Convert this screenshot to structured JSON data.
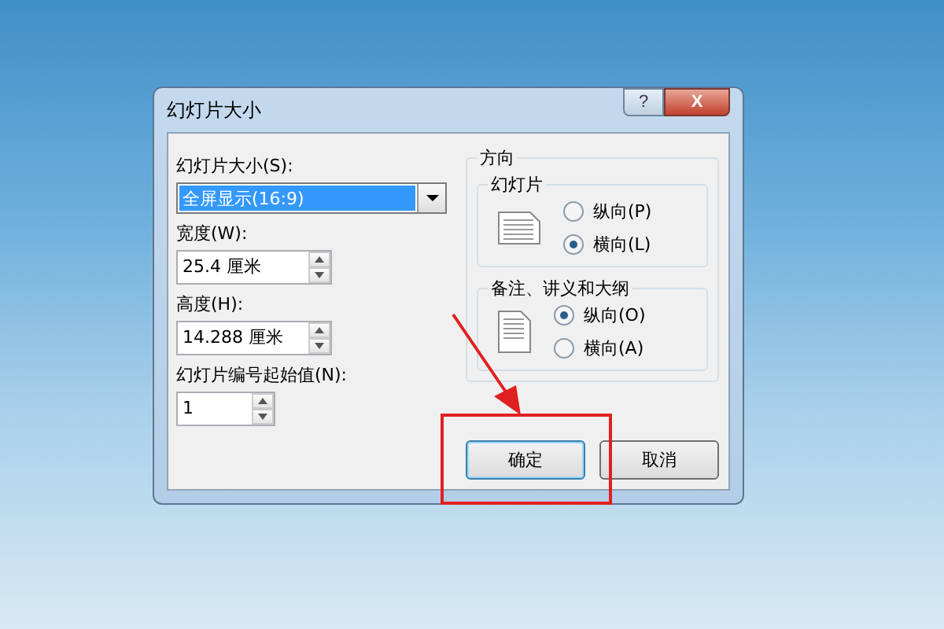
{
  "window": {
    "title": "幻灯片大小",
    "help_button": "?",
    "close_button": "X"
  },
  "slide_size": {
    "label": "幻灯片大小(S):",
    "value": "全屏显示(16:9)"
  },
  "width": {
    "label": "宽度(W):",
    "value": "25.4 厘米"
  },
  "height": {
    "label": "高度(H):",
    "value": "14.288 厘米"
  },
  "start_number": {
    "label": "幻灯片编号起始值(N):",
    "value": "1"
  },
  "orientation": {
    "title": "方向",
    "groups": [
      {
        "title": "幻灯片",
        "kind": "landscape",
        "options": [
          {
            "label": "纵向(P)",
            "selected": false
          },
          {
            "label": "横向(L)",
            "selected": true
          }
        ]
      },
      {
        "title": "备注、讲义和大纲",
        "kind": "portrait",
        "options": [
          {
            "label": "纵向(O)",
            "selected": true
          },
          {
            "label": "横向(A)",
            "selected": false
          }
        ]
      }
    ]
  },
  "buttons": [
    {
      "label": "确定",
      "default": true
    },
    {
      "label": "取消",
      "default": false
    }
  ]
}
